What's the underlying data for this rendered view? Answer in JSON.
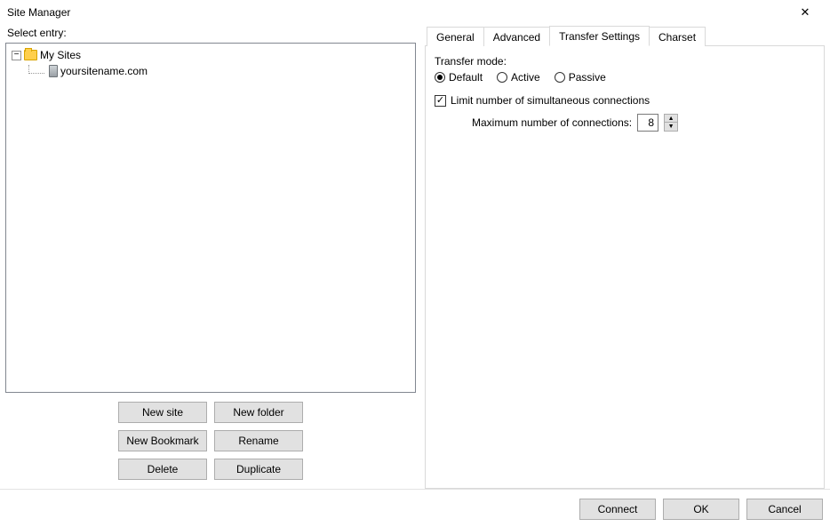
{
  "window": {
    "title": "Site Manager"
  },
  "left": {
    "select_label": "Select entry:",
    "root_label": "My Sites",
    "site_label": "yoursitename.com",
    "buttons": {
      "new_site": "New site",
      "new_folder": "New folder",
      "new_bookmark": "New Bookmark",
      "rename": "Rename",
      "delete": "Delete",
      "duplicate": "Duplicate"
    }
  },
  "tabs": {
    "general": "General",
    "advanced": "Advanced",
    "transfer": "Transfer Settings",
    "charset": "Charset",
    "active": "transfer"
  },
  "transfer": {
    "mode_label": "Transfer mode:",
    "default": "Default",
    "active": "Active",
    "passive": "Passive",
    "selected_mode": "default",
    "limit_label": "Limit number of simultaneous connections",
    "limit_checked": true,
    "max_label": "Maximum number of connections:",
    "max_value": "8"
  },
  "footer": {
    "connect": "Connect",
    "ok": "OK",
    "cancel": "Cancel"
  }
}
